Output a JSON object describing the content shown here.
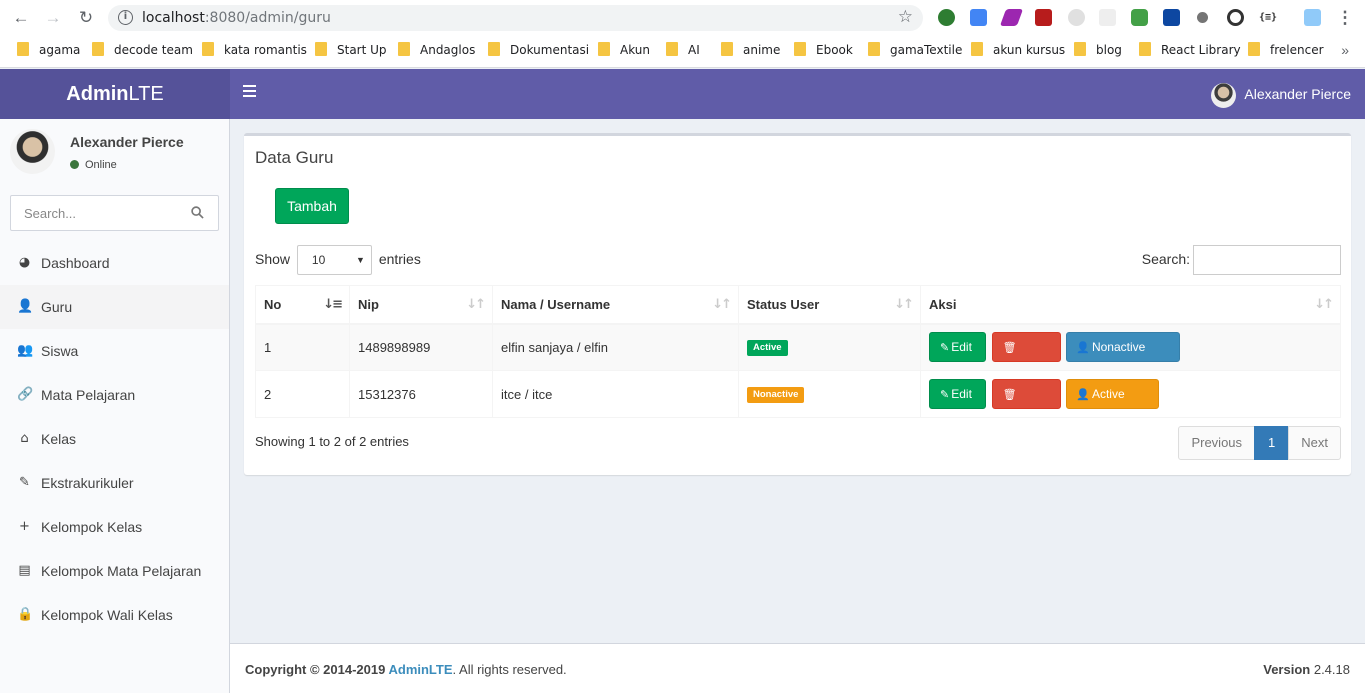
{
  "browser": {
    "url_host": "localhost",
    "url_rest": ":8080/admin/guru",
    "bookmarks": [
      "agama",
      "decode team",
      "kata romantis",
      "Start Up",
      "Andaglos",
      "Dokumentasi",
      "Akun",
      "AI",
      "anime",
      "Ebook",
      "gamaTextile",
      "akun kursus",
      "blog",
      "React Library",
      "frelencer"
    ],
    "more": "»"
  },
  "header": {
    "logo_bold": "Admin",
    "logo_rest": "LTE",
    "user_name": "Alexander Pierce"
  },
  "sidebar": {
    "user_name": "Alexander Pierce",
    "status": "Online",
    "search_placeholder": "Search...",
    "items": [
      {
        "label": "Dashboard",
        "icon": "tachometer-icon",
        "glyph": "◕"
      },
      {
        "label": "Guru",
        "icon": "user-icon",
        "glyph": "👤"
      },
      {
        "label": "Siswa",
        "icon": "users-icon",
        "glyph": "👥"
      },
      {
        "label": "Mata Pelajaran",
        "icon": "link-icon",
        "glyph": "🔗"
      },
      {
        "label": "Kelas",
        "icon": "home-icon",
        "glyph": "⌂"
      },
      {
        "label": "Ekstrakurikuler",
        "icon": "edit-icon",
        "glyph": "✎"
      },
      {
        "label": "Kelompok Kelas",
        "icon": "user-plus-icon",
        "glyph": "+"
      },
      {
        "label": "Kelompok Mata Pelajaran",
        "icon": "book-icon",
        "glyph": "▤"
      },
      {
        "label": "Kelompok Wali Kelas",
        "icon": "lock-icon",
        "glyph": "🔒"
      }
    ],
    "active_index": 1
  },
  "main": {
    "title": "Data Guru",
    "add_button": "Tambah",
    "show_label": "Show",
    "entries_label": "entries",
    "page_length": "10",
    "search_label": "Search:",
    "columns": [
      "No",
      "Nip",
      "Nama / Username",
      "Status User",
      "Aksi"
    ],
    "rows": [
      {
        "no": "1",
        "nip": "1489898989",
        "nama": "elfin sanjaya / elfin",
        "status": "Active",
        "edit": "Edit",
        "delete": "Delete",
        "toggle": "Nonactive User"
      },
      {
        "no": "2",
        "nip": "15312376",
        "nama": "itce / itce",
        "status": "Nonactive",
        "edit": "Edit",
        "delete": "Delete",
        "toggle": "Active User"
      }
    ],
    "info": "Showing 1 to 2 of 2 entries",
    "pagination": {
      "previous": "Previous",
      "current": "1",
      "next": "Next"
    }
  },
  "footer": {
    "copyright_prefix": "Copyright © 2014-2019 ",
    "brand": "AdminLTE",
    "suffix": ". All rights reserved.",
    "version_label": "Version",
    "version": "2.4.18"
  },
  "colors": {
    "header": "#605ca8",
    "logo_bg": "#555299",
    "success": "#00a65a",
    "danger": "#dd4b39",
    "primary": "#3c8dbc",
    "warning": "#f39c12"
  }
}
